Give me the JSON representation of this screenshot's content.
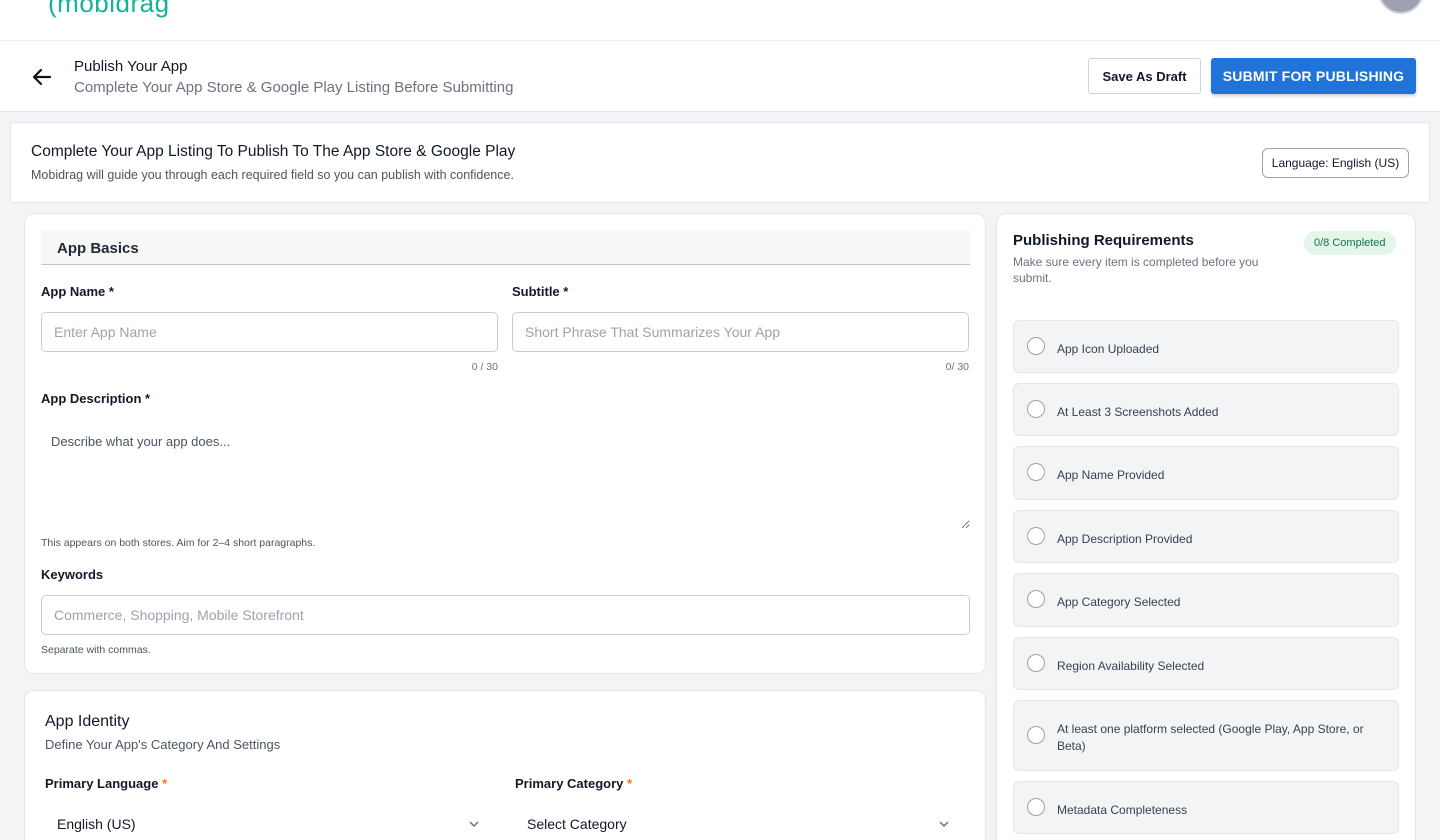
{
  "app": {
    "logo_text": "(mobidrag"
  },
  "header": {
    "title": "Publish Your App",
    "subtitle": "Complete Your App Store & Google Play Listing Before Submitting",
    "save_draft_label": "Save As Draft",
    "submit_label": "SUBMIT FOR PUBLISHING"
  },
  "intro": {
    "title": "Complete Your App Listing To Publish To The App Store & Google Play",
    "subtitle": "Mobidrag will guide you through each required field so you can publish with confidence.",
    "language_button": "Language: English (US)"
  },
  "basics": {
    "section_title": "App Basics",
    "app_name": {
      "label": "App Name *",
      "placeholder": "Enter App Name",
      "value": "",
      "counter": "0 / 30"
    },
    "subtitle": {
      "label": "Subtitle *",
      "placeholder": "Short Phrase That Summarizes Your App",
      "value": "",
      "counter": "0/ 30"
    },
    "description": {
      "label": "App Description *",
      "placeholder": "Describe what your app does...",
      "hint": "This appears on both stores. Aim for 2–4 short paragraphs."
    },
    "keywords": {
      "label": "Keywords",
      "placeholder": "Commerce, Shopping, Mobile Storefront",
      "hint": "Separate with commas."
    }
  },
  "identity": {
    "title": "App Identity",
    "subtitle": "Define Your App's Category And Settings",
    "primary_language": {
      "label": "Primary Language",
      "required_mark": "*",
      "value": "English (US)"
    },
    "primary_category": {
      "label": "Primary Category",
      "required_mark": "*",
      "value": "Select Category"
    }
  },
  "requirements": {
    "title": "Publishing Requirements",
    "subtitle": "Make sure every item is completed before you submit.",
    "badge": "0/8 Completed",
    "items": [
      {
        "label": "App Icon Uploaded",
        "done": false
      },
      {
        "label": "At Least 3 Screenshots Added",
        "done": false
      },
      {
        "label": "App Name Provided",
        "done": false
      },
      {
        "label": "App Description Provided",
        "done": false
      },
      {
        "label": "App Category Selected",
        "done": false
      },
      {
        "label": "Region Availability Selected",
        "done": false
      },
      {
        "label": "At least one platform selected (Google Play, App Store, or Beta)",
        "done": false
      },
      {
        "label": "Metadata Completeness",
        "done": false
      }
    ]
  },
  "colors": {
    "accent": "#1f73d9",
    "brand": "#16b39a",
    "badge_bg": "#e4f5ea",
    "badge_text": "#16704a"
  }
}
